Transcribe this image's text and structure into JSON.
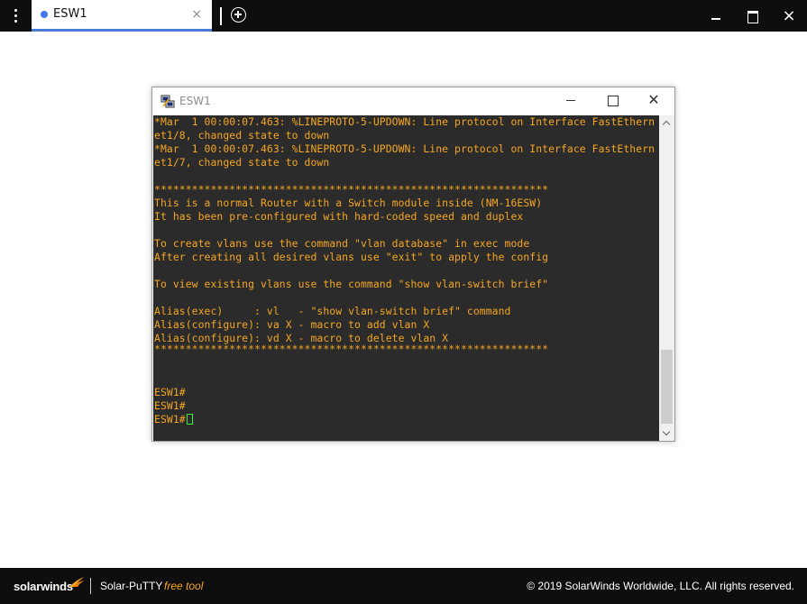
{
  "tabs": [
    {
      "label": "ESW1",
      "active": true,
      "close_glyph": "×"
    }
  ],
  "icons": {
    "menu": "more-vert-icon",
    "tab_status": "dot-icon",
    "add_tab": "add-circle-icon",
    "putty_app": "putty-icon"
  },
  "window_controls": {
    "minimize": "minimize-icon",
    "maximize": "maximize-icon",
    "close": "×"
  },
  "putty": {
    "title": "ESW1",
    "close_glyph": "✕",
    "terminal_lines": [
      "*Mar  1 00:00:07.463: %LINEPROTO-5-UPDOWN: Line protocol on Interface FastEthern",
      "et1/8, changed state to down",
      "*Mar  1 00:00:07.463: %LINEPROTO-5-UPDOWN: Line protocol on Interface FastEthern",
      "et1/7, changed state to down",
      "",
      "***************************************************************",
      "This is a normal Router with a Switch module inside (NM-16ESW)",
      "It has been pre-configured with hard-coded speed and duplex",
      "",
      "To create vlans use the command \"vlan database\" in exec mode",
      "After creating all desired vlans use \"exit\" to apply the config",
      "",
      "To view existing vlans use the command \"show vlan-switch brief\"",
      "",
      "Alias(exec)     : vl   - \"show vlan-switch brief\" command",
      "Alias(configure): va X - macro to add vlan X",
      "Alias(configure): vd X - macro to delete vlan X",
      "***************************************************************",
      "",
      "",
      "",
      "ESW1#",
      "ESW1#",
      "ESW1#"
    ],
    "text_color": "#f5a623",
    "background_color": "#2b2b2b",
    "cursor_color": "#3cf03c"
  },
  "footer": {
    "brand": "solarwinds",
    "product": "Solar-PuTTY",
    "product_tag": "free tool",
    "copyright": "© 2019 SolarWinds Worldwide, LLC. All rights reserved."
  },
  "colors": {
    "accent": "#3b78f0",
    "brand_orange": "#f5a623",
    "chrome": "#0e0e0e"
  }
}
